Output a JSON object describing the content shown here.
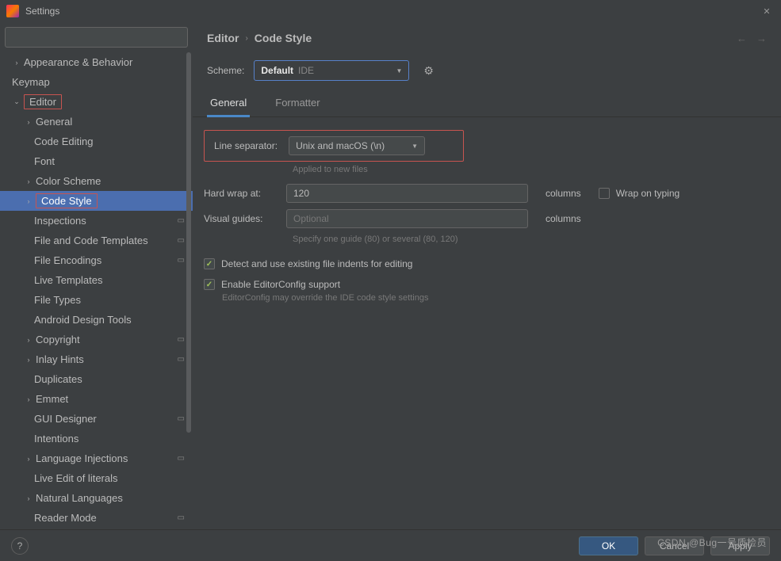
{
  "window": {
    "title": "Settings"
  },
  "search": {
    "placeholder": ""
  },
  "tree": [
    {
      "label": "Appearance & Behavior",
      "level": 0,
      "arrow": "right",
      "highlight": false
    },
    {
      "label": "Keymap",
      "level": 0,
      "arrow": "",
      "highlight": false
    },
    {
      "label": "Editor",
      "level": 0,
      "arrow": "down",
      "highlight": true
    },
    {
      "label": "General",
      "level": 1,
      "arrow": "right",
      "highlight": false
    },
    {
      "label": "Code Editing",
      "level": 1,
      "arrow": "",
      "highlight": false
    },
    {
      "label": "Font",
      "level": 1,
      "arrow": "",
      "highlight": false
    },
    {
      "label": "Color Scheme",
      "level": 1,
      "arrow": "right",
      "highlight": false
    },
    {
      "label": "Code Style",
      "level": 1,
      "arrow": "right",
      "highlight": true,
      "selected": true
    },
    {
      "label": "Inspections",
      "level": 1,
      "arrow": "",
      "badge": "▭",
      "highlight": false
    },
    {
      "label": "File and Code Templates",
      "level": 1,
      "arrow": "",
      "badge": "▭",
      "highlight": false
    },
    {
      "label": "File Encodings",
      "level": 1,
      "arrow": "",
      "badge": "▭",
      "highlight": false
    },
    {
      "label": "Live Templates",
      "level": 1,
      "arrow": "",
      "highlight": false
    },
    {
      "label": "File Types",
      "level": 1,
      "arrow": "",
      "highlight": false
    },
    {
      "label": "Android Design Tools",
      "level": 1,
      "arrow": "",
      "highlight": false
    },
    {
      "label": "Copyright",
      "level": 1,
      "arrow": "right",
      "badge": "▭",
      "highlight": false
    },
    {
      "label": "Inlay Hints",
      "level": 1,
      "arrow": "right",
      "badge": "▭",
      "highlight": false
    },
    {
      "label": "Duplicates",
      "level": 1,
      "arrow": "",
      "highlight": false
    },
    {
      "label": "Emmet",
      "level": 1,
      "arrow": "right",
      "highlight": false
    },
    {
      "label": "GUI Designer",
      "level": 1,
      "arrow": "",
      "badge": "▭",
      "highlight": false
    },
    {
      "label": "Intentions",
      "level": 1,
      "arrow": "",
      "highlight": false
    },
    {
      "label": "Language Injections",
      "level": 1,
      "arrow": "right",
      "badge": "▭",
      "highlight": false
    },
    {
      "label": "Live Edit of literals",
      "level": 1,
      "arrow": "",
      "highlight": false
    },
    {
      "label": "Natural Languages",
      "level": 1,
      "arrow": "right",
      "highlight": false
    },
    {
      "label": "Reader Mode",
      "level": 1,
      "arrow": "",
      "badge": "▭",
      "highlight": false
    }
  ],
  "breadcrumb": {
    "a": "Editor",
    "b": "Code Style"
  },
  "scheme": {
    "label": "Scheme:",
    "value": "Default",
    "suffix": "IDE"
  },
  "tabs": {
    "general": "General",
    "formatter": "Formatter"
  },
  "form": {
    "line_sep_label": "Line separator:",
    "line_sep_value": "Unix and macOS (\\n)",
    "line_sep_hint": "Applied to new files",
    "hard_wrap_label": "Hard wrap at:",
    "hard_wrap_value": "120",
    "columns": "columns",
    "wrap_on_typing": "Wrap on typing",
    "visual_guides_label": "Visual guides:",
    "visual_guides_placeholder": "Optional",
    "visual_guides_hint": "Specify one guide (80) or several (80, 120)",
    "detect_indents": "Detect and use existing file indents for editing",
    "editor_config": "Enable EditorConfig support",
    "editor_config_hint": "EditorConfig may override the IDE code style settings"
  },
  "footer": {
    "ok": "OK",
    "cancel": "Cancel",
    "apply": "Apply"
  },
  "watermark": "CSDN @Bug一号质检员"
}
